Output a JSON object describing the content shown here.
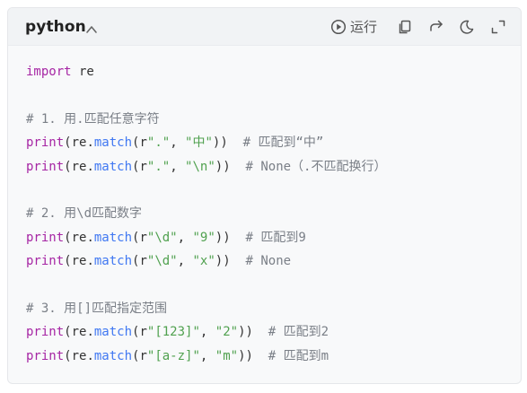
{
  "header": {
    "language": "python",
    "run_label": "运行"
  },
  "icons": {
    "collapse": "chevron-up-icon",
    "run": "play-circle-icon",
    "copy": "copy-icon",
    "wrap": "wrap-redo-icon",
    "theme": "moon-icon",
    "fullscreen": "fullscreen-icon"
  },
  "code": {
    "l1": {
      "kw": "import",
      "rest": " re"
    },
    "l3": {
      "comment": "# 1. 用.匹配任意字符"
    },
    "l4": {
      "fn": "print",
      "p1": "(re.",
      "m": "match",
      "p2": "(r",
      "s1": "\".\"",
      "p3": ", ",
      "s2": "\"中\"",
      "p4": "))  ",
      "comment": "# 匹配到“中”"
    },
    "l5": {
      "fn": "print",
      "p1": "(re.",
      "m": "match",
      "p2": "(r",
      "s1": "\".\"",
      "p3": ", ",
      "s2": "\"\\n\"",
      "p4": "))  ",
      "comment": "# None（.不匹配换行）"
    },
    "l7": {
      "comment": "# 2. 用\\d匹配数字"
    },
    "l8": {
      "fn": "print",
      "p1": "(re.",
      "m": "match",
      "p2": "(r",
      "s1": "\"\\d\"",
      "p3": ", ",
      "s2": "\"9\"",
      "p4": "))  ",
      "comment": "# 匹配到9"
    },
    "l9": {
      "fn": "print",
      "p1": "(re.",
      "m": "match",
      "p2": "(r",
      "s1": "\"\\d\"",
      "p3": ", ",
      "s2": "\"x\"",
      "p4": "))  ",
      "comment": "# None"
    },
    "l11": {
      "comment": "# 3. 用[]匹配指定范围"
    },
    "l12": {
      "fn": "print",
      "p1": "(re.",
      "m": "match",
      "p2": "(r",
      "s1": "\"[123]\"",
      "p3": ", ",
      "s2": "\"2\"",
      "p4": "))  ",
      "comment": "# 匹配到2"
    },
    "l13": {
      "fn": "print",
      "p1": "(re.",
      "m": "match",
      "p2": "(r",
      "s1": "\"[a-z]\"",
      "p3": ", ",
      "s2": "\"m\"",
      "p4": "))  ",
      "comment": "# 匹配到m"
    }
  }
}
